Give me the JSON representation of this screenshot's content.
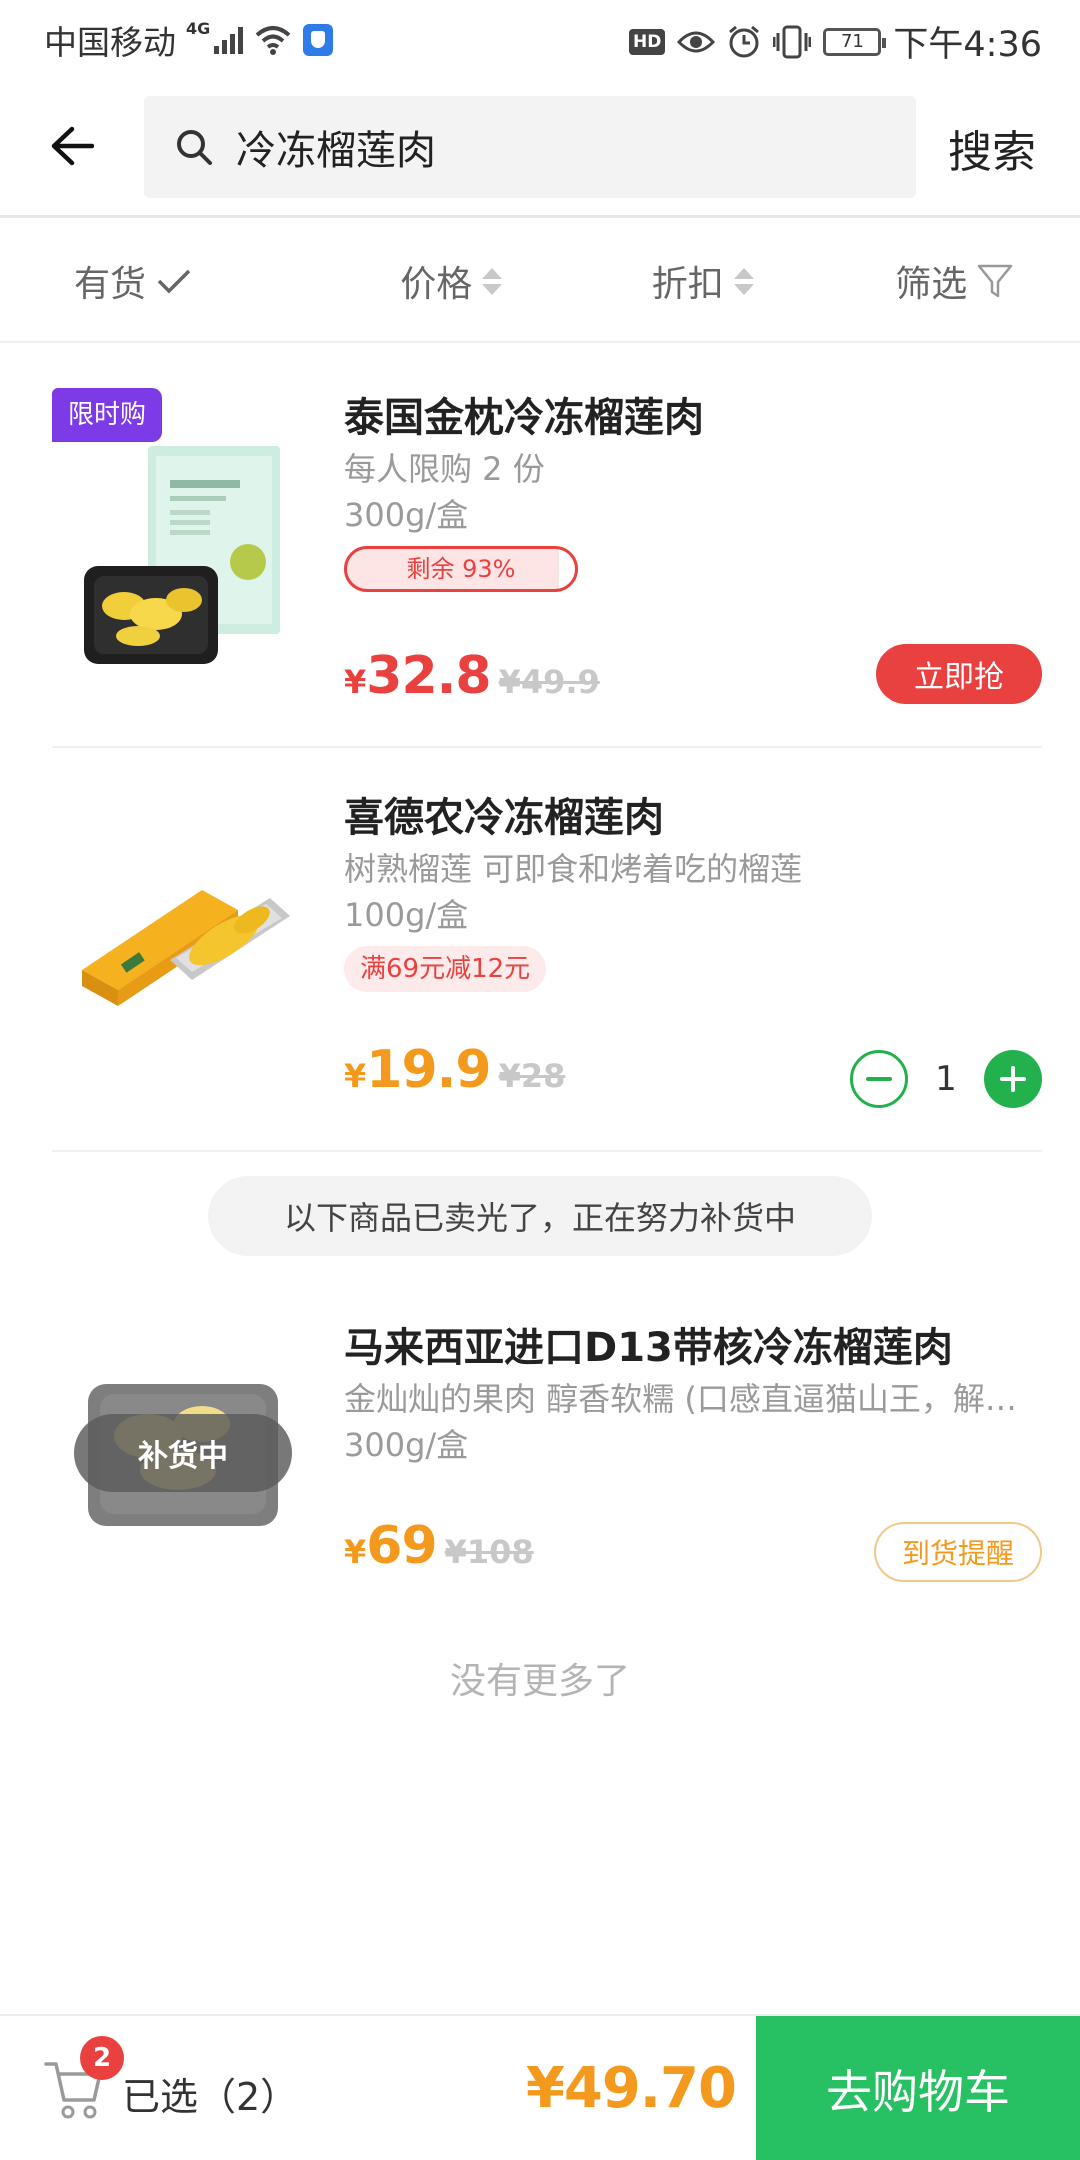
{
  "status_bar": {
    "carrier": "中国移动",
    "network": "4G",
    "hd": "HD",
    "battery": "71",
    "time": "下午4:36"
  },
  "search": {
    "query": "冷冻榴莲肉",
    "action_label": "搜索"
  },
  "filters": {
    "in_stock": "有货",
    "price": "价格",
    "discount": "折扣",
    "filter": "筛选"
  },
  "products": [
    {
      "badge": "限时购",
      "title": "泰国金枕冷冻榴莲肉",
      "desc1": "每人限购 2 份",
      "desc2": "300g/盒",
      "remaining": "剩余 93%",
      "remaining_fraction": 0.93,
      "currency": "¥",
      "price": "32.8",
      "original_price": "¥49.9",
      "action": "立即抢",
      "price_color": "#e8413f"
    },
    {
      "title": "喜德农冷冻榴莲肉",
      "desc1": "树熟榴莲  可即食和烤着吃的榴莲",
      "desc2": "100g/盒",
      "promo": "满69元减12元",
      "currency": "¥",
      "price": "19.9",
      "original_price": "¥28",
      "quantity": "1",
      "price_color": "#f39a1e"
    },
    {
      "title": "马来西亚进口D13带核冷冻榴莲肉",
      "desc1": "金灿灿的果肉 醇香软糯 (口感直逼猫山王，解冻后更佳)",
      "desc2": "300g/盒",
      "overlay": "补货中",
      "currency": "¥",
      "price": "69",
      "original_price": "¥108",
      "action": "到货提醒",
      "price_color": "#f39a1e"
    }
  ],
  "soldout_notice": "以下商品已卖光了，正在努力补货中",
  "no_more": "没有更多了",
  "cart": {
    "badge_count": "2",
    "selected_label": "已选（2）",
    "total": "¥49.70",
    "checkout": "去购物车"
  },
  "colors": {
    "accent_green": "#27c062",
    "price_red": "#e8413f",
    "price_orange": "#f39a1e",
    "flash_purple": "#7c3be6"
  }
}
